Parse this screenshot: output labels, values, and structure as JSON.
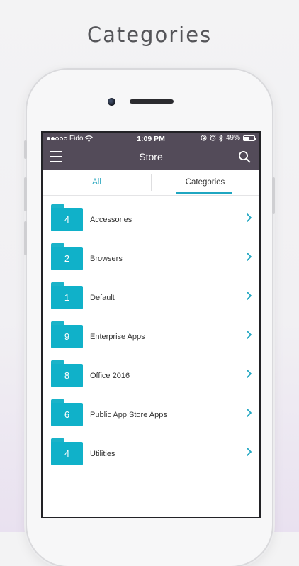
{
  "headline": "Categories",
  "status": {
    "carrier": "Fido",
    "time": "1:09 PM",
    "battery": "49%",
    "battery_level": 0.49,
    "signal_filled": 2,
    "signal_total": 5
  },
  "nav": {
    "title": "Store"
  },
  "tabs": {
    "all": "All",
    "categories": "Categories"
  },
  "categories": [
    {
      "count": "4",
      "name": "Accessories"
    },
    {
      "count": "2",
      "name": "Browsers"
    },
    {
      "count": "1",
      "name": "Default"
    },
    {
      "count": "9",
      "name": "Enterprise Apps"
    },
    {
      "count": "8",
      "name": "Office 2016"
    },
    {
      "count": "6",
      "name": "Public App Store Apps"
    },
    {
      "count": "4",
      "name": "Utilities"
    }
  ],
  "colors": {
    "accent": "#1fa6c1",
    "folder": "#10b1c9",
    "topbar": "#534b59"
  }
}
